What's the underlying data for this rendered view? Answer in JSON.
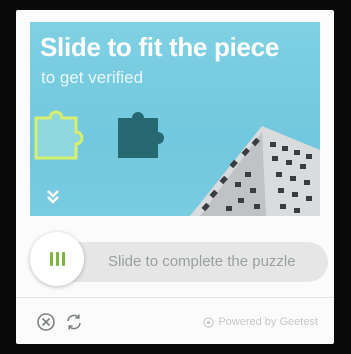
{
  "captcha": {
    "title": "Slide to fit the piece",
    "subtitle": "to get verified",
    "slider_label": "Slide to complete the puzzle",
    "powered_by": "Powered by Geetest"
  },
  "icons": {
    "hint_arrow": "double-chevron-down-icon",
    "knob_grip": "grip-bars-icon",
    "close": "close-circle-icon",
    "refresh": "refresh-icon",
    "brand": "geetest-logo-icon"
  },
  "colors": {
    "puzzle_background": "#7fd0e3",
    "accent_green": "#7cb342",
    "piece_outline": "#d7ef6f"
  }
}
